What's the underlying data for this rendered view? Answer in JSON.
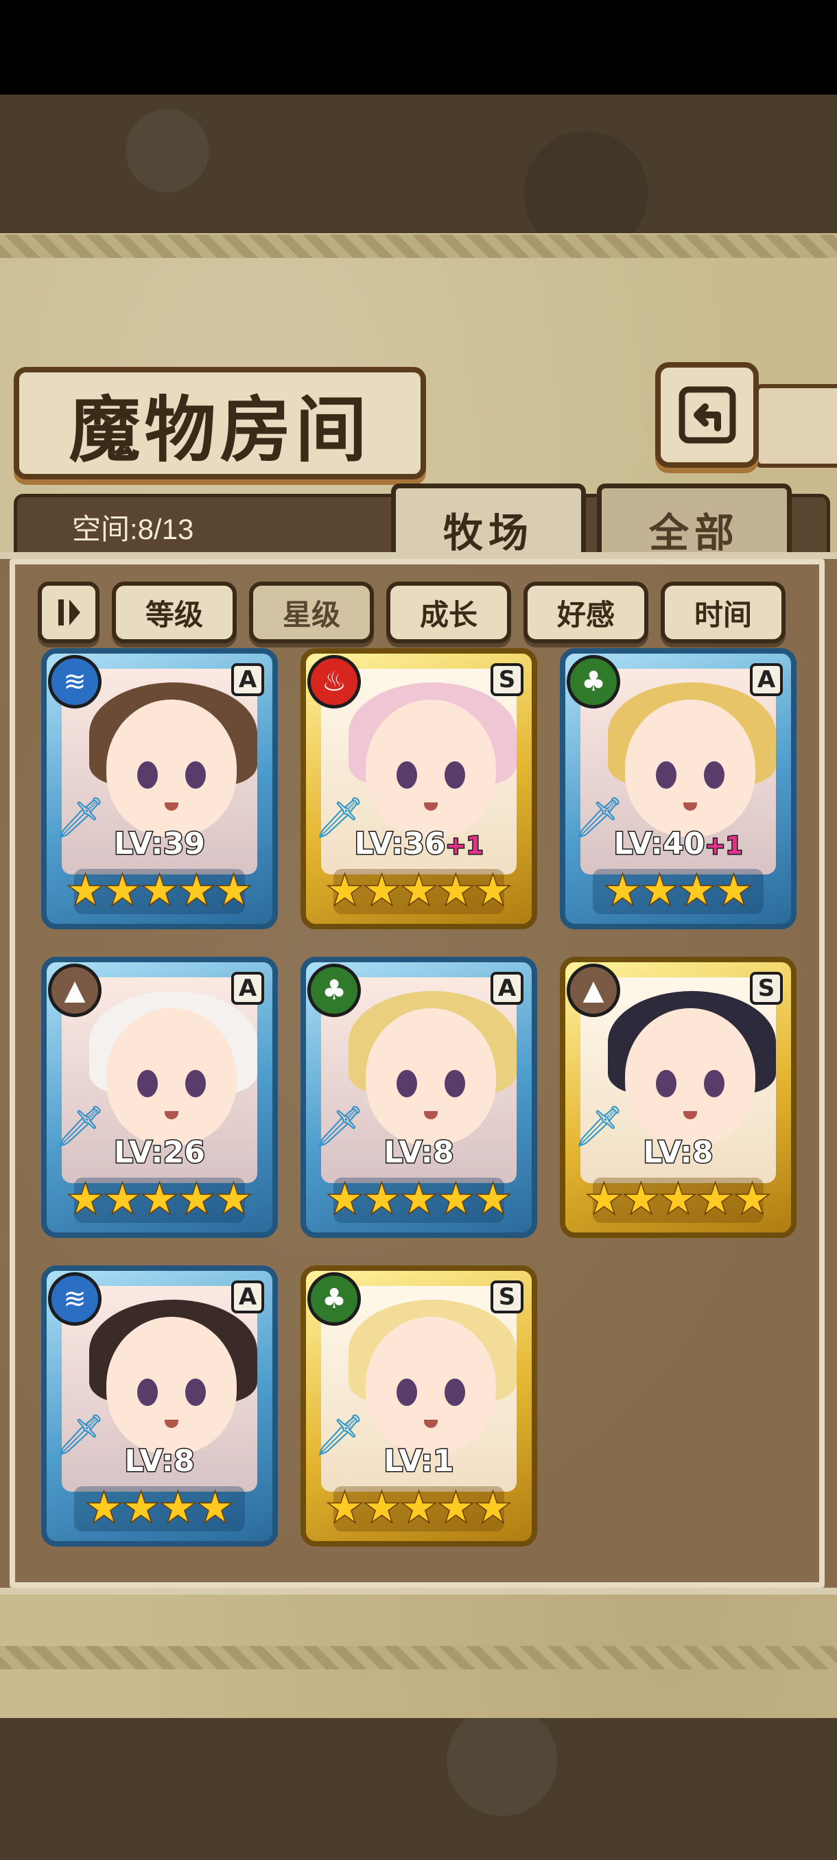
{
  "header": {
    "title": "魔物房间",
    "back_icon": "back-arrow-icon"
  },
  "info": {
    "space_label": "空间:8/13"
  },
  "tabs": [
    {
      "label": "牧场",
      "active": true
    },
    {
      "label": "全部",
      "active": false
    }
  ],
  "sort": {
    "toggle_icon": "sort-order-icon",
    "buttons": [
      {
        "label": "等级",
        "active": false
      },
      {
        "label": "星级",
        "active": true
      },
      {
        "label": "成长",
        "active": false
      },
      {
        "label": "好感",
        "active": false
      },
      {
        "label": "时间",
        "active": false
      }
    ]
  },
  "monsters": [
    {
      "element": "water",
      "rank": "A",
      "level": "LV:39",
      "bonus": "",
      "stars": 5,
      "frame": "blue"
    },
    {
      "element": "fire",
      "rank": "S",
      "level": "LV:36",
      "bonus": "+1",
      "stars": 5,
      "frame": "gold"
    },
    {
      "element": "wood",
      "rank": "A",
      "level": "LV:40",
      "bonus": "+1",
      "stars": 4,
      "frame": "blue"
    },
    {
      "element": "earth",
      "rank": "A",
      "level": "LV:26",
      "bonus": "",
      "stars": 5,
      "frame": "blue"
    },
    {
      "element": "wood",
      "rank": "A",
      "level": "LV:8",
      "bonus": "",
      "stars": 5,
      "frame": "blue"
    },
    {
      "element": "earth",
      "rank": "S",
      "level": "LV:8",
      "bonus": "",
      "stars": 5,
      "frame": "gold"
    },
    {
      "element": "water",
      "rank": "A",
      "level": "LV:8",
      "bonus": "",
      "stars": 4,
      "frame": "blue"
    },
    {
      "element": "wood",
      "rank": "S",
      "level": "LV:1",
      "bonus": "",
      "stars": 5,
      "frame": "gold"
    }
  ],
  "colors": {
    "water": "#2a6fc4",
    "fire": "#d6261e",
    "wood": "#2f7a2b",
    "earth": "#7a5a44",
    "star": "#ffcb22"
  }
}
